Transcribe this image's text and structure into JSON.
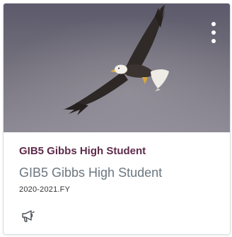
{
  "card": {
    "title": "GIB5 Gibbs High Student",
    "subtitle": "GIB5 Gibbs High Student",
    "term": "2020-2021.FY",
    "image_icon": "bald-eagle-image",
    "menu_icon": "kebab-menu-icon",
    "action_icon": "megaphone-icon"
  },
  "colors": {
    "title": "#5e2b4b",
    "subtitle": "#6b7780",
    "sky_top": "#5c5a6b",
    "sky_bottom": "#8d8a96"
  }
}
